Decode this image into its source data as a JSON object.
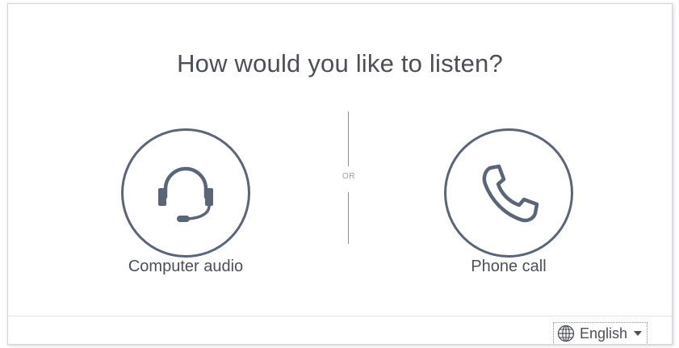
{
  "dialog": {
    "title": "How would you like to listen?",
    "options": [
      {
        "label": "Computer audio",
        "icon": "headset-icon"
      },
      {
        "label": "Phone call",
        "icon": "phone-icon"
      }
    ],
    "divider_text": "OR"
  },
  "footer": {
    "language": "English",
    "language_icon": "globe-icon"
  },
  "colors": {
    "icon": "#5a6578",
    "text": "#4a4f58",
    "divider": "#8a8f97"
  }
}
